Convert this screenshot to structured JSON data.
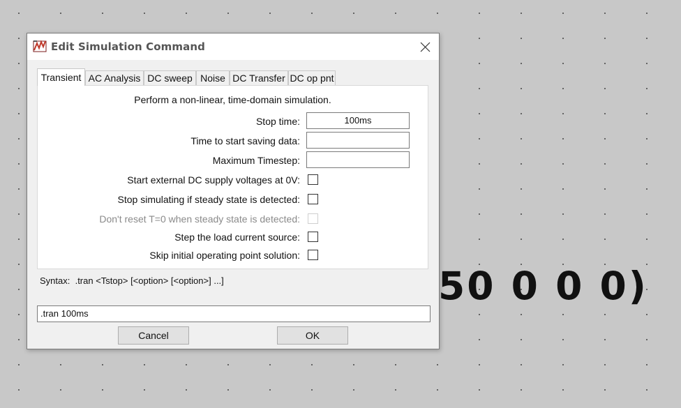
{
  "background": {
    "netlist_fragment": "50 0 0 0)"
  },
  "dialog": {
    "title": "Edit Simulation Command",
    "tabs": [
      {
        "label": "Transient",
        "active": true
      },
      {
        "label": "AC Analysis",
        "active": false
      },
      {
        "label": "DC sweep",
        "active": false
      },
      {
        "label": "Noise",
        "active": false
      },
      {
        "label": "DC Transfer",
        "active": false
      },
      {
        "label": "DC op pnt",
        "active": false
      }
    ],
    "transient": {
      "description": "Perform a non-linear, time-domain simulation.",
      "stop_time": {
        "label": "Stop time:",
        "value": "100ms"
      },
      "start_saving": {
        "label": "Time to start saving data:",
        "value": ""
      },
      "max_timestep": {
        "label": "Maximum Timestep:",
        "value": ""
      },
      "options": [
        {
          "label": "Start external DC supply voltages at 0V:",
          "checked": false,
          "enabled": true
        },
        {
          "label": "Stop simulating if steady state is detected:",
          "checked": false,
          "enabled": true
        },
        {
          "label": "Don't reset T=0 when steady state is detected:",
          "checked": false,
          "enabled": false
        },
        {
          "label": "Step the load current source:",
          "checked": false,
          "enabled": true
        },
        {
          "label": "Skip initial operating point solution:",
          "checked": false,
          "enabled": true
        }
      ]
    },
    "syntax": "Syntax:  .tran <Tstop> [<option> [<option>] ...]",
    "command": ".tran 100ms",
    "buttons": {
      "cancel": "Cancel",
      "ok": "OK"
    },
    "icons": {
      "app": "ltspice-app-icon",
      "close": "close-icon"
    },
    "colors": {
      "icon_red": "#c0392b",
      "window_bg": "#f0f0f0",
      "canvas_bg": "#c8c8c8"
    }
  }
}
